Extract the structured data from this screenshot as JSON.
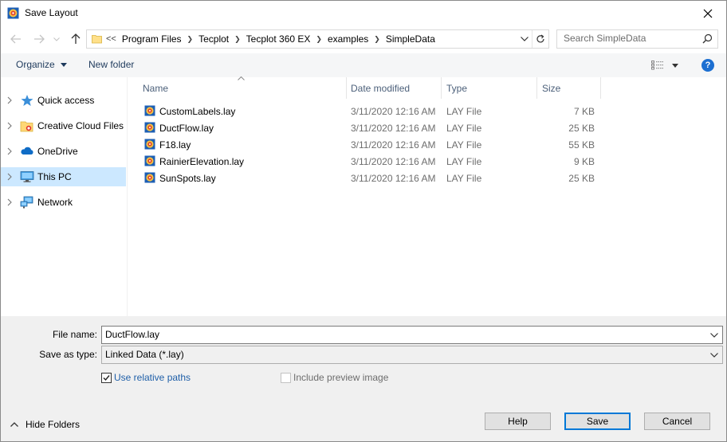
{
  "window": {
    "title": "Save Layout"
  },
  "address": {
    "overflow": "<<",
    "crumbs": [
      "Program Files",
      "Tecplot",
      "Tecplot 360 EX",
      "examples",
      "SimpleData"
    ]
  },
  "search": {
    "placeholder": "Search SimpleData"
  },
  "toolbar": {
    "organize": "Organize",
    "new_folder": "New folder",
    "help": "?"
  },
  "sidebar": {
    "items": [
      {
        "label": "Quick access",
        "icon": "star-icon"
      },
      {
        "label": "Creative Cloud Files",
        "icon": "creative-cloud-folder-icon"
      },
      {
        "label": "OneDrive",
        "icon": "cloud-icon"
      },
      {
        "label": "This PC",
        "icon": "computer-icon",
        "selected": true
      },
      {
        "label": "Network",
        "icon": "network-icon"
      }
    ]
  },
  "files": {
    "columns": {
      "name": "Name",
      "date": "Date modified",
      "type": "Type",
      "size": "Size"
    },
    "rows": [
      {
        "name": "CustomLabels.lay",
        "date": "3/11/2020 12:16 AM",
        "type": "LAY File",
        "size": "7 KB"
      },
      {
        "name": "DuctFlow.lay",
        "date": "3/11/2020 12:16 AM",
        "type": "LAY File",
        "size": "25 KB"
      },
      {
        "name": "F18.lay",
        "date": "3/11/2020 12:16 AM",
        "type": "LAY File",
        "size": "55 KB"
      },
      {
        "name": "RainierElevation.lay",
        "date": "3/11/2020 12:16 AM",
        "type": "LAY File",
        "size": "9 KB"
      },
      {
        "name": "SunSpots.lay",
        "date": "3/11/2020 12:16 AM",
        "type": "LAY File",
        "size": "25 KB"
      }
    ]
  },
  "form": {
    "file_name_label": "File name:",
    "file_name_value": "DuctFlow.lay",
    "save_type_label": "Save as type:",
    "save_type_value": "Linked Data (*.lay)",
    "relative_paths_label": "Use relative paths",
    "relative_paths_checked": true,
    "preview_label": "Include preview image",
    "preview_checked": false
  },
  "footer": {
    "hide_folders": "Hide Folders",
    "help": "Help",
    "save": "Save",
    "cancel": "Cancel"
  },
  "colors": {
    "accent": "#0078d7",
    "selection": "#cce8ff",
    "link": "#1e3a5c"
  }
}
